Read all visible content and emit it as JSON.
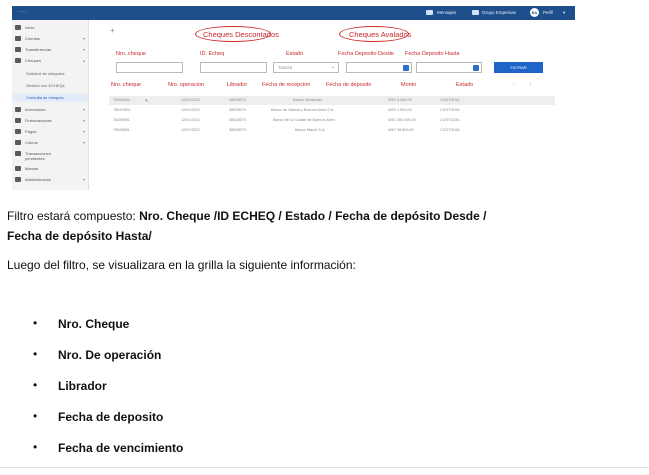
{
  "app": {
    "brand": "·····",
    "topbar": {
      "item1": "Mensajes",
      "item2": "Grupo Empresas",
      "avatar_initials": "EA",
      "user": "Perfil"
    }
  },
  "sidebar": {
    "items": [
      {
        "label": "Inicio"
      },
      {
        "label": "Cuentas"
      },
      {
        "label": "Transferencias"
      },
      {
        "label": "Cheques"
      },
      {
        "label": "Solicitud de chequera"
      },
      {
        "label": "Gestión con ECHEQs"
      },
      {
        "label": "Consulta de cheques"
      },
      {
        "label": "Inversiones"
      },
      {
        "label": "Financiaciones"
      },
      {
        "label": "Pagos"
      },
      {
        "label": "Cobros"
      },
      {
        "label": "Transacciones pendientes"
      },
      {
        "label": "Manual"
      },
      {
        "label": "Administración"
      }
    ]
  },
  "tabs": {
    "descontados": "Cheques Descontados",
    "avalados": "Cheques Avalados"
  },
  "filters": {
    "nro_cheque": "Nro. cheque",
    "id_echeq": "ID. Echeq",
    "estado": "Estado",
    "estado_value": "TODOS",
    "fecha_desde": "Fecha Deposito Desde",
    "fecha_hasta": "Fecha Deposito Hasta",
    "filter_button": "FILTRAR"
  },
  "table": {
    "headers": [
      "Nro. cheque",
      "Nro. operacion",
      "Librador",
      "Fecha de recepcion",
      "Fecha de deposito",
      "Monto",
      "Estado"
    ],
    "rows": [
      [
        "78956630",
        "12/01/2021",
        "38833570",
        "Banco Santander",
        "ARS 2.450,00",
        "CUSTODIA"
      ],
      [
        "78947854",
        "12/01/2021",
        "38833570",
        "Banco de Galicia y Buenos Aires S.A.",
        "ARS 1.500,00",
        "CUSTODIA"
      ],
      [
        "78459891",
        "12/01/2021",
        "38833570",
        "Banco de la Ciudad de Buenos Aires",
        "ARS 350.000,00",
        "CUSTODIA"
      ],
      [
        "78564851",
        "12/01/2021",
        "38833570",
        "Banco Macro S.A.",
        "ARS 38.500,00",
        "CUSTODIA"
      ]
    ]
  },
  "doc": {
    "filter_prefix": "Filtro estará compuesto: ",
    "filter_bold_1": "Nro. Cheque /ID ECHEQ / Estado / Fecha de depósito  Desde /",
    "filter_bold_2": "Fecha de depósito Hasta/",
    "intro": "Luego del filtro, se visualizara en la grilla la siguiente información:",
    "bullet_char": "•",
    "bullets": [
      "Nro. Cheque",
      "Nro. De operación",
      "Librador",
      "Fecha de deposito",
      "Fecha de vencimiento"
    ]
  }
}
